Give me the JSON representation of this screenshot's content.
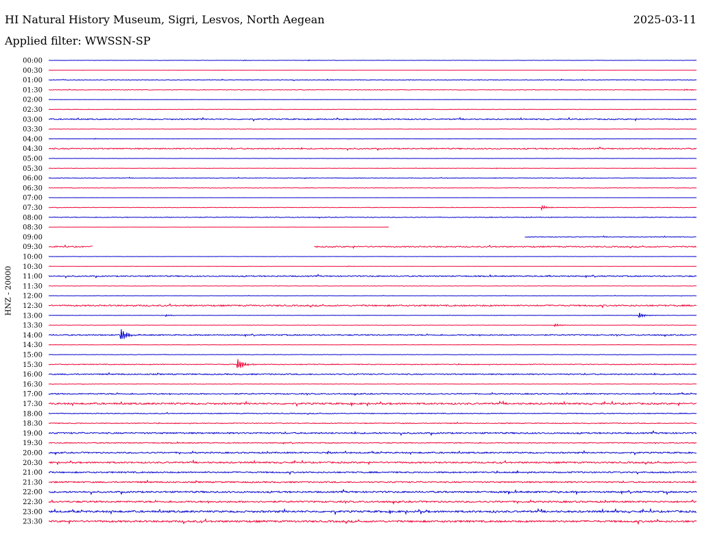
{
  "header": {
    "station": "HI Natural History Museum, Sigri, Lesvos, North Aegean",
    "date": "2025-03-11",
    "filter": "Applied filter: WWSSN-SP"
  },
  "chart_data": {
    "type": "line",
    "title": "HI Natural History Museum, Sigri, Lesvos, North Aegean",
    "subtitle": "Applied filter: WWSSN-SP",
    "date": "2025-03-11",
    "ylabel": "HNZ - 20000",
    "xlabel": "",
    "line_colors": [
      "#0000cc",
      "#ee0033"
    ],
    "grid": false,
    "legend": "none",
    "rows": [
      {
        "label": "00:00",
        "noise": 0.2,
        "events": [
          {
            "x": 0.3,
            "amp": 1
          },
          {
            "x": 0.4,
            "amp": 1
          }
        ]
      },
      {
        "label": "00:30",
        "noise": 0.1,
        "events": []
      },
      {
        "label": "01:00",
        "noise": 0.5,
        "events": []
      },
      {
        "label": "01:30",
        "noise": 0.5,
        "events": [
          {
            "x": 0.9,
            "amp": 1
          },
          {
            "x": 0.98,
            "amp": 1
          }
        ]
      },
      {
        "label": "02:00",
        "noise": 0.2,
        "events": []
      },
      {
        "label": "02:30",
        "noise": 0.4,
        "events": []
      },
      {
        "label": "03:00",
        "noise": 1.0,
        "events": []
      },
      {
        "label": "03:30",
        "noise": 0.3,
        "events": []
      },
      {
        "label": "04:00",
        "noise": 0.3,
        "events": [
          {
            "x": 0.07,
            "amp": 1
          }
        ]
      },
      {
        "label": "04:30",
        "noise": 1.0,
        "events": []
      },
      {
        "label": "05:00",
        "noise": 0.2,
        "events": []
      },
      {
        "label": "05:30",
        "noise": 0.3,
        "events": [
          {
            "x": 0.69,
            "amp": 1
          },
          {
            "x": 0.73,
            "amp": 1
          }
        ]
      },
      {
        "label": "06:00",
        "noise": 0.5,
        "events": []
      },
      {
        "label": "06:30",
        "noise": 0.4,
        "events": []
      },
      {
        "label": "07:00",
        "noise": 0.1,
        "events": []
      },
      {
        "label": "07:30",
        "noise": 0.4,
        "events": [
          {
            "x": 0.76,
            "amp": 4
          }
        ]
      },
      {
        "label": "08:00",
        "noise": 0.6,
        "events": []
      },
      {
        "label": "08:30",
        "noise": 0.1,
        "events": [],
        "data_range": [
          0,
          0.525
        ]
      },
      {
        "label": "09:00",
        "noise": 0.6,
        "events": [],
        "data_range": [
          0.735,
          1
        ]
      },
      {
        "label": "09:30",
        "noise": 1.0,
        "events": [],
        "data_range": [
          0,
          0.068
        ],
        "data_range_2": [
          0.41,
          1
        ]
      },
      {
        "label": "10:00",
        "noise": 0.2,
        "events": []
      },
      {
        "label": "10:30",
        "noise": 0.2,
        "events": [
          {
            "x": 0.46,
            "amp": 1
          }
        ]
      },
      {
        "label": "11:00",
        "noise": 1.0,
        "events": [
          {
            "x": 0.77,
            "amp": 2
          }
        ]
      },
      {
        "label": "11:30",
        "noise": 0.3,
        "events": []
      },
      {
        "label": "12:00",
        "noise": 0.3,
        "events": []
      },
      {
        "label": "12:30",
        "noise": 1.2,
        "events": []
      },
      {
        "label": "13:00",
        "noise": 0.3,
        "events": [
          {
            "x": 0.18,
            "amp": 2
          },
          {
            "x": 0.91,
            "amp": 5
          }
        ]
      },
      {
        "label": "13:30",
        "noise": 0.3,
        "events": [
          {
            "x": 0.78,
            "amp": 3
          }
        ]
      },
      {
        "label": "14:00",
        "noise": 1.0,
        "events": [
          {
            "x": 0.11,
            "amp": 14
          }
        ]
      },
      {
        "label": "14:30",
        "noise": 0.3,
        "events": []
      },
      {
        "label": "15:00",
        "noise": 0.3,
        "events": []
      },
      {
        "label": "15:30",
        "noise": 0.7,
        "events": [
          {
            "x": 0.29,
            "amp": 12
          }
        ]
      },
      {
        "label": "16:00",
        "noise": 1.0,
        "events": []
      },
      {
        "label": "16:30",
        "noise": 0.3,
        "events": []
      },
      {
        "label": "17:00",
        "noise": 1.0,
        "events": []
      },
      {
        "label": "17:30",
        "noise": 1.4,
        "events": []
      },
      {
        "label": "18:00",
        "noise": 0.7,
        "events": []
      },
      {
        "label": "18:30",
        "noise": 0.7,
        "events": []
      },
      {
        "label": "19:00",
        "noise": 1.3,
        "events": []
      },
      {
        "label": "19:30",
        "noise": 0.8,
        "events": []
      },
      {
        "label": "20:00",
        "noise": 1.2,
        "events": [
          {
            "x": 0.43,
            "amp": 3
          }
        ]
      },
      {
        "label": "20:30",
        "noise": 1.3,
        "events": []
      },
      {
        "label": "21:00",
        "noise": 1.2,
        "events": []
      },
      {
        "label": "21:30",
        "noise": 1.2,
        "events": []
      },
      {
        "label": "22:00",
        "noise": 1.4,
        "events": []
      },
      {
        "label": "22:30",
        "noise": 1.4,
        "events": []
      },
      {
        "label": "23:00",
        "noise": 1.6,
        "events": []
      },
      {
        "label": "23:30",
        "noise": 1.6,
        "events": []
      }
    ]
  }
}
